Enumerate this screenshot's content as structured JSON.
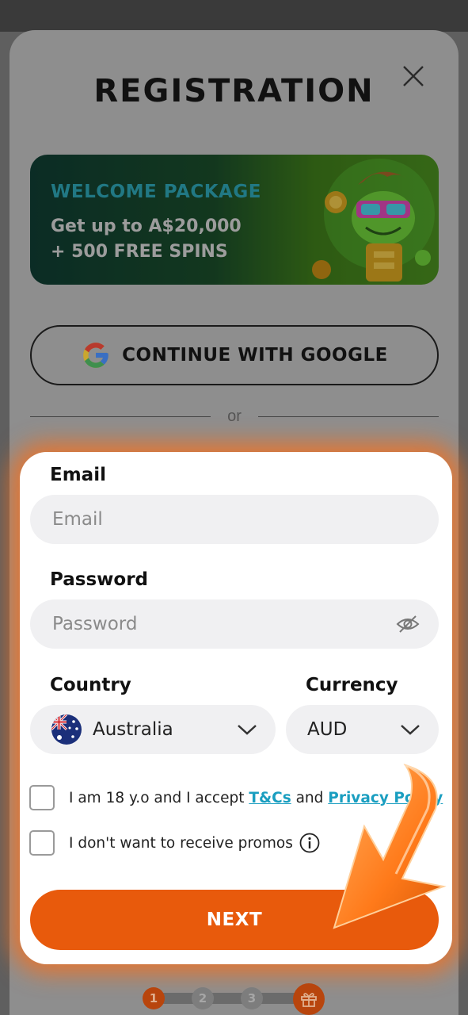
{
  "modal": {
    "title": "REGISTRATION"
  },
  "banner": {
    "kicker": "WELCOME PACKAGE",
    "line1": "Get up to A$20,000",
    "line2": "+ 500 FREE SPINS"
  },
  "google": {
    "label": "CONTINUE WITH GOOGLE"
  },
  "divider": {
    "text": "or"
  },
  "form": {
    "email_label": "Email",
    "email_placeholder": "Email",
    "password_label": "Password",
    "password_placeholder": "Password",
    "country_label": "Country",
    "country_value": "Australia",
    "currency_label": "Currency",
    "currency_value": "AUD",
    "terms_prefix": "I am 18 y.o and I accept ",
    "terms_link": "T&Cs",
    "terms_and": " and ",
    "privacy_link": "Privacy Policy",
    "promos_text": "I don't want to receive promos",
    "next_label": "NEXT"
  },
  "steps": {
    "step1": "1",
    "step2": "2",
    "step3": "3"
  },
  "colors": {
    "accent": "#e85a0c",
    "link": "#1a9ec0",
    "banner_kicker": "#2ea6b8"
  }
}
